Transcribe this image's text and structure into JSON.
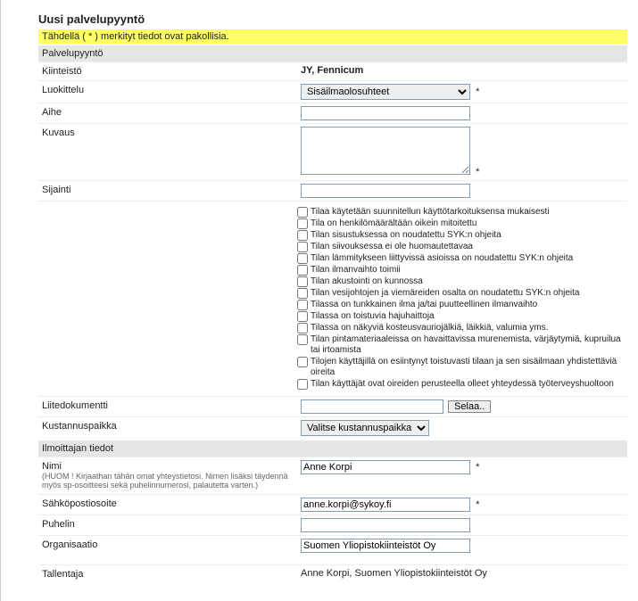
{
  "title": "Uusi palvelupyyntö",
  "hint": "Tähdellä ( * ) merkityt tiedot ovat pakollisia.",
  "section_request": "Palvelupyyntö",
  "labels": {
    "kiinteisto": "Kiinteistö",
    "luokittelu": "Luokittelu",
    "aihe": "Aihe",
    "kuvaus": "Kuvaus",
    "sijainti": "Sijainti",
    "liite": "Liitedokumentti",
    "kustannus": "Kustannuspaikka",
    "nimi": "Nimi",
    "nimi_sub": "(HUOM ! Kirjaathan tähän omat yhteystietosi. Nimen lisäksi täydennä myös sp-osoitteesi sekä puhelinnumerosi, palautetta varten.)",
    "email": "Sähköpostiosoite",
    "puhelin": "Puhelin",
    "org": "Organisaatio",
    "tallentaja": "Tallentaja"
  },
  "section_ilmoittaja": "Ilmoittajan tiedot",
  "values": {
    "kiinteisto": "JY, Fennicum",
    "luokittelu_selected": "Sisäilmaolosuhteet",
    "kustannus_selected": "Valitse kustannuspaikka",
    "selaa_btn": "Selaa..",
    "nimi": "Anne Korpi",
    "email": "anne.korpi@sykoy.fi",
    "org": "Suomen Yliopistokiinteistöt Oy",
    "tallentaja": "Anne Korpi, Suomen Yliopistokiinteistöt Oy",
    "req": "*"
  },
  "checks": [
    "Tilaa käytetään suunnitellun käyttötarkoituksensa mukaisesti",
    "Tila on henkilömäärältään oikein mitoitettu",
    "Tilan sisustuksessa on noudatettu SYK:n ohjeita",
    "Tilan siivouksessa ei ole huomautettavaa",
    "Tilan lämmitykseen liittyvissä asioissa on noudatettu SYK:n ohjeita",
    "Tilan ilmanvaihto toimii",
    "Tilan akustointi on kunnossa",
    "Tilan vesijohtojen ja viemäreiden osalta on noudatettu SYK:n ohjeita",
    "Tilassa on tunkkainen ilma ja/tai puutteellinen ilmanvaihto",
    "Tilassa on toistuvia hajuhaittoja",
    "Tilassa on näkyviä kosteusvauriojälkiä, läikkiä, valumia yms.",
    "Tilan pintamateriaaleissa on havaittavissa murenemista, värjäytymiä, kupruilua tai irtoamista",
    "Tilojen käyttäjillä on esiintynyt toistuvasti tilaan ja sen sisäilmaan yhdistettäviä oireita",
    "Tilan käyttäjät ovat oireiden perusteella olleet yhteydessä työterveyshuoltoon"
  ]
}
